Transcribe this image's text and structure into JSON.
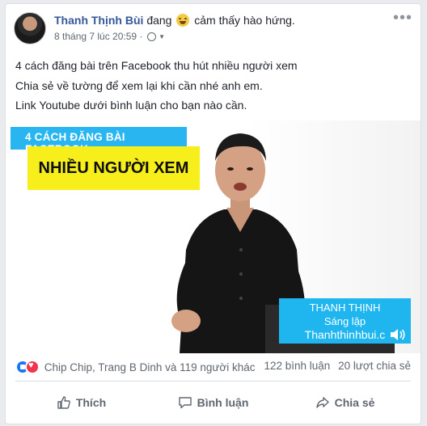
{
  "post": {
    "author": "Thanh Thịnh Bùi",
    "status_prefix": "đang",
    "status_feeling": "cảm thấy hào hứng.",
    "timestamp": "8 tháng 7 lúc 20:59",
    "separator": "·",
    "privacy_icon": "globe-icon",
    "lines": [
      "4 cách đăng bài trên Facebook thu hút nhiều người xem",
      "Chia sẻ về tường để xem lại khi cần nhé anh em.",
      "Link Youtube dưới bình luận cho bạn nào cần."
    ]
  },
  "video": {
    "title_top": "4 CÁCH ĐĂNG BÀI FACEBOOK",
    "title_main": "NHIỀU NGƯỜI XEM",
    "presenter_name": "THANH THỊNH",
    "presenter_role": "Sáng lập",
    "presenter_site": "Thanhthinhbui.c",
    "colors": {
      "blue": "#29b6f0",
      "yellow": "#f7ef1c"
    }
  },
  "reactions": {
    "icons": [
      "like-icon",
      "love-icon"
    ],
    "reactors": "Chip Chip, Trang B Dinh và 119 người khác",
    "comments": "122 bình luận",
    "shares": "20 lượt chia sẻ"
  },
  "actions": {
    "like": "Thích",
    "comment": "Bình luận",
    "share": "Chia sẻ"
  }
}
